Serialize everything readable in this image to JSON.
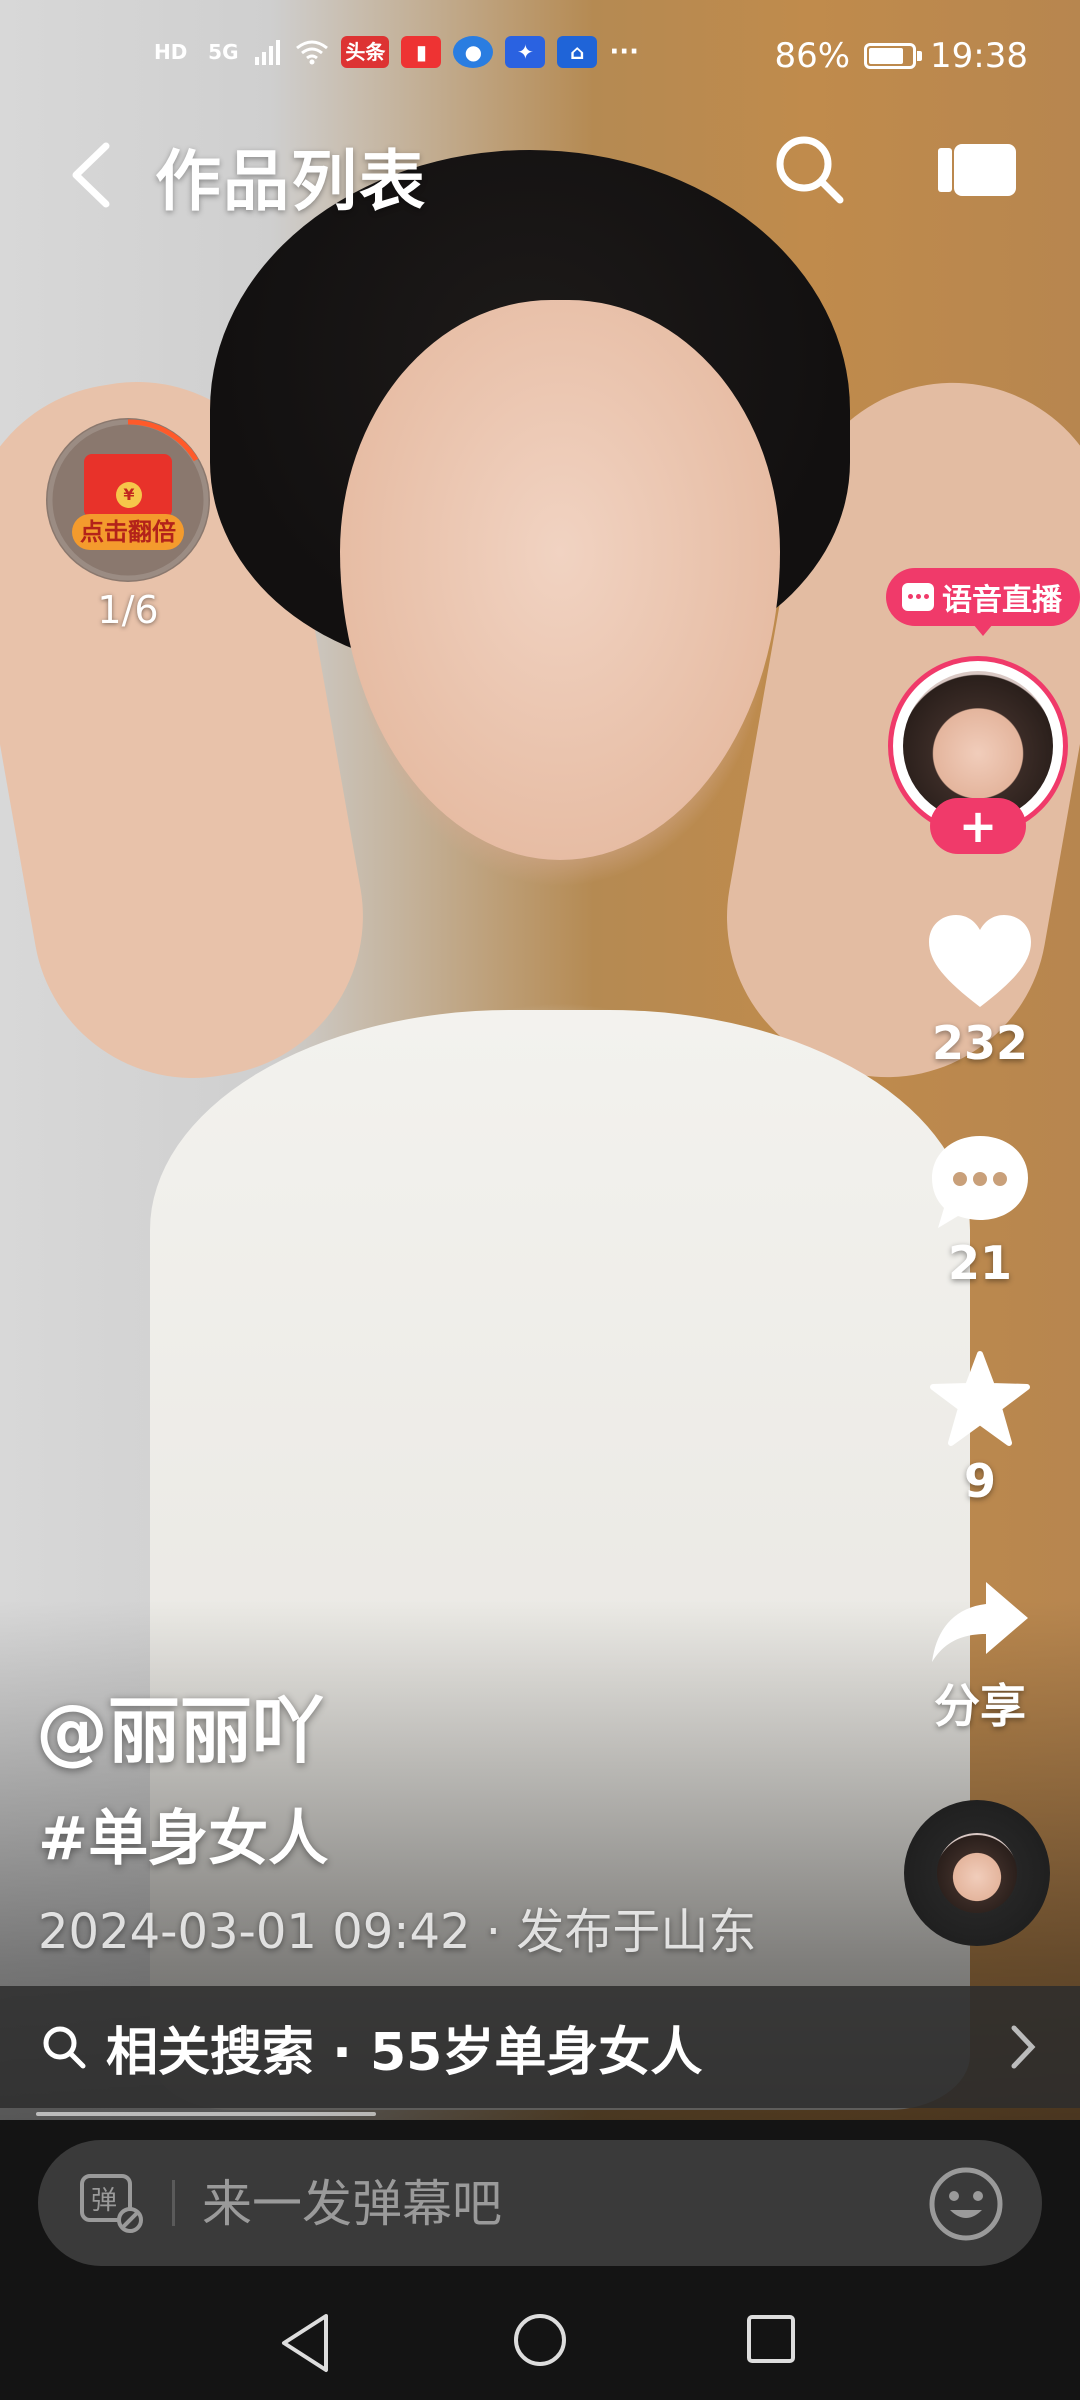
{
  "status_bar": {
    "left_indicators": [
      "HD",
      "5G",
      "头条"
    ],
    "battery_percent": "86%",
    "battery_level": 0.86,
    "time": "19:38",
    "more": "···"
  },
  "nav": {
    "title": "作品列表"
  },
  "red_packet": {
    "label": "点击翻倍",
    "coin": "¥",
    "counter": "1/6"
  },
  "live_badge": {
    "label": "语音直播"
  },
  "follow": {
    "label": "+"
  },
  "actions": {
    "likes": "232",
    "comments": "21",
    "favorites": "9",
    "share": "分享"
  },
  "post": {
    "author": "@丽丽吖",
    "hashtag": "#单身女人",
    "meta": "2024-03-01 09:42 · 发布于山东"
  },
  "related_search": {
    "text": "相关搜索 · 55岁单身女人"
  },
  "danmaku": {
    "placeholder": "来一发弹幕吧"
  },
  "colors": {
    "accent_pink": "#f03a6a",
    "danmaku_bar": "#3a3a3a",
    "related_bar": "#2d2d2d"
  },
  "icons": [
    "back-icon",
    "search-icon",
    "camera-icon",
    "heart-icon",
    "comment-icon",
    "star-icon",
    "share-icon",
    "search-icon",
    "chevron-right-icon",
    "danmaku-toggle-icon",
    "emoji-icon",
    "nav-back-icon",
    "nav-home-icon",
    "nav-recents-icon"
  ]
}
